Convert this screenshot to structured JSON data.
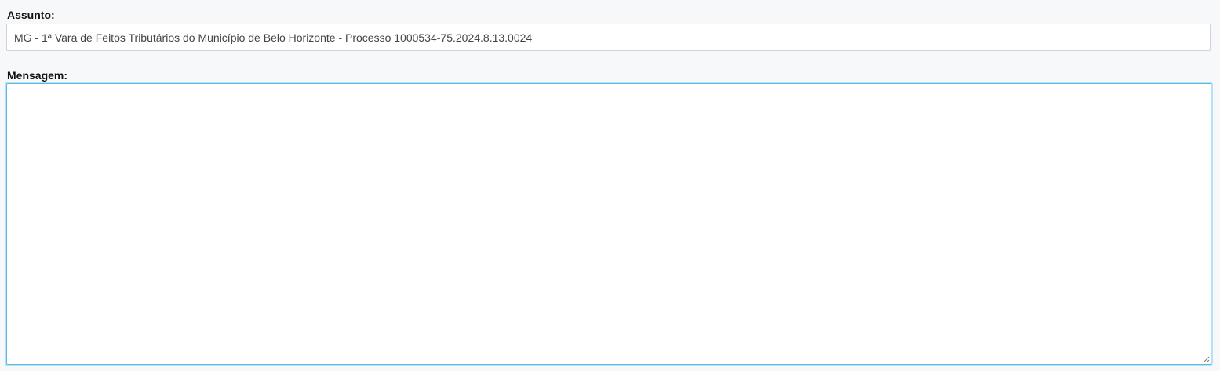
{
  "form": {
    "subject_label": "Assunto:",
    "subject_value": "MG - 1ª Vara de Feitos Tributários do Município de Belo Horizonte - Processo 1000534-75.2024.8.13.0024",
    "message_label": "Mensagem:",
    "message_value": ""
  },
  "colors": {
    "background": "#f7f8fa",
    "focus_border": "#5fb7e8",
    "input_border": "#ced4da"
  }
}
